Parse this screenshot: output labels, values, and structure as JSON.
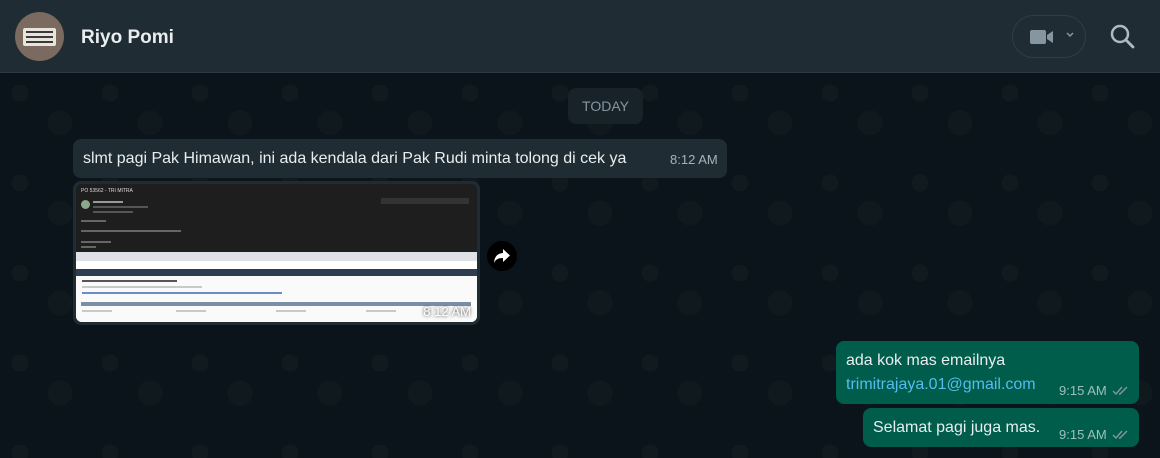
{
  "header": {
    "contact_name": "Riyo Pomi",
    "icons": [
      "avatar",
      "video-call-icon",
      "chevron-down-icon",
      "search-icon"
    ]
  },
  "chat": {
    "day_label": "TODAY",
    "messages": [
      {
        "direction": "incoming",
        "type": "text",
        "text": "slmt pagi Pak Himawan, ini ada kendala dari Pak Rudi minta tolong di cek ya",
        "time": "8:12 AM"
      },
      {
        "direction": "incoming",
        "type": "image",
        "time": "8:12 AM",
        "forward_icon": "forward-icon"
      },
      {
        "direction": "outgoing",
        "type": "text",
        "line1": "ada kok mas emailnya",
        "link": "trimitrajaya.01@gmail.com",
        "time": "9:15 AM",
        "status": "read"
      },
      {
        "direction": "outgoing",
        "type": "text",
        "text": "Selamat pagi juga mas.",
        "time": "9:15 AM",
        "status": "read"
      }
    ]
  },
  "colors": {
    "background": "#0b141a",
    "header": "#202c33",
    "incoming_bubble": "#202c33",
    "outgoing_bubble": "#005c4b",
    "link": "#53bdeb",
    "tick_read": "#8696a0"
  }
}
